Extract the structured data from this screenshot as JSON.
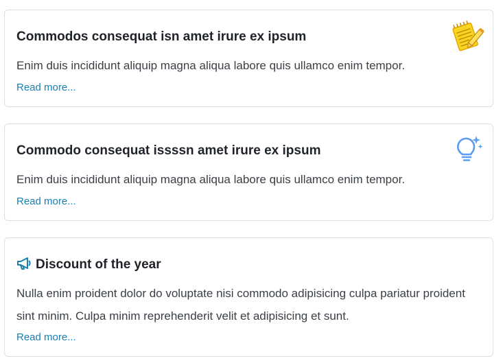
{
  "cards": [
    {
      "title": "Commodos consequat isn amet irure ex ipsum",
      "body": "Enim duis incididunt aliquip magna aliqua labore quis ullamco enim tempor.",
      "link": "Read more...",
      "icon": "notepad-pencil-icon",
      "icon_color": "#f5c518"
    },
    {
      "title": "Commodo consequat issssn amet irure ex ipsum",
      "body": "Enim duis incididunt aliquip magna aliqua labore quis ullamco enim tempor.",
      "link": "Read more...",
      "icon": "lightbulb-sparkle-icon",
      "icon_color": "#5b9bf0"
    },
    {
      "title": "Discount of the year",
      "body": "Nulla enim proident dolor do voluptate nisi commodo adipisicing culpa pariatur proident sint minim. Culpa minim reprehenderit velit et adipisicing et sunt.",
      "link": "Read more...",
      "icon": "megaphone-icon",
      "icon_color": "#1a7fae"
    }
  ],
  "colors": {
    "link": "#1a7fae",
    "title": "#1f2329",
    "body": "#3a3f45",
    "border": "#dcdfe4"
  }
}
